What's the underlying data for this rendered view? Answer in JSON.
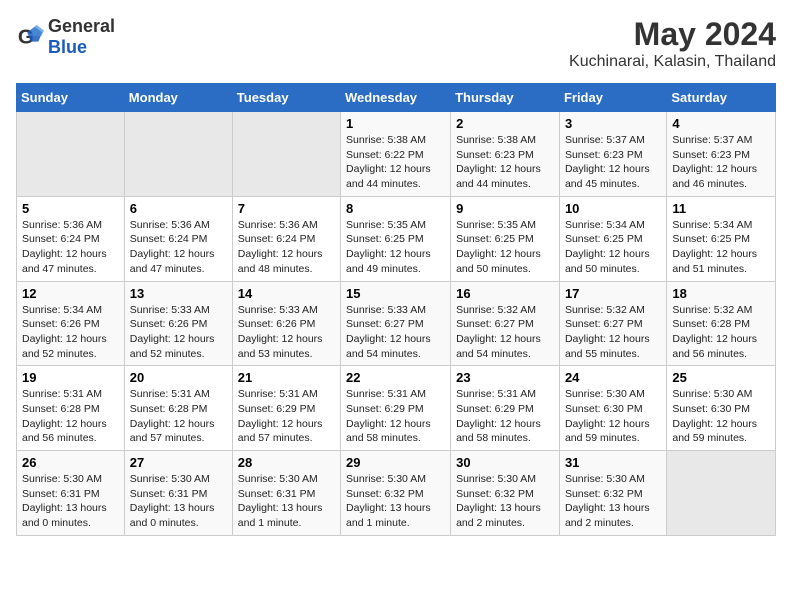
{
  "header": {
    "logo_general": "General",
    "logo_blue": "Blue",
    "title": "May 2024",
    "subtitle": "Kuchinarai, Kalasin, Thailand"
  },
  "days_of_week": [
    "Sunday",
    "Monday",
    "Tuesday",
    "Wednesday",
    "Thursday",
    "Friday",
    "Saturday"
  ],
  "weeks": [
    [
      {
        "day": "",
        "info": ""
      },
      {
        "day": "",
        "info": ""
      },
      {
        "day": "",
        "info": ""
      },
      {
        "day": "1",
        "info": "Sunrise: 5:38 AM\nSunset: 6:22 PM\nDaylight: 12 hours\nand 44 minutes."
      },
      {
        "day": "2",
        "info": "Sunrise: 5:38 AM\nSunset: 6:23 PM\nDaylight: 12 hours\nand 44 minutes."
      },
      {
        "day": "3",
        "info": "Sunrise: 5:37 AM\nSunset: 6:23 PM\nDaylight: 12 hours\nand 45 minutes."
      },
      {
        "day": "4",
        "info": "Sunrise: 5:37 AM\nSunset: 6:23 PM\nDaylight: 12 hours\nand 46 minutes."
      }
    ],
    [
      {
        "day": "5",
        "info": "Sunrise: 5:36 AM\nSunset: 6:24 PM\nDaylight: 12 hours\nand 47 minutes."
      },
      {
        "day": "6",
        "info": "Sunrise: 5:36 AM\nSunset: 6:24 PM\nDaylight: 12 hours\nand 47 minutes."
      },
      {
        "day": "7",
        "info": "Sunrise: 5:36 AM\nSunset: 6:24 PM\nDaylight: 12 hours\nand 48 minutes."
      },
      {
        "day": "8",
        "info": "Sunrise: 5:35 AM\nSunset: 6:25 PM\nDaylight: 12 hours\nand 49 minutes."
      },
      {
        "day": "9",
        "info": "Sunrise: 5:35 AM\nSunset: 6:25 PM\nDaylight: 12 hours\nand 50 minutes."
      },
      {
        "day": "10",
        "info": "Sunrise: 5:34 AM\nSunset: 6:25 PM\nDaylight: 12 hours\nand 50 minutes."
      },
      {
        "day": "11",
        "info": "Sunrise: 5:34 AM\nSunset: 6:25 PM\nDaylight: 12 hours\nand 51 minutes."
      }
    ],
    [
      {
        "day": "12",
        "info": "Sunrise: 5:34 AM\nSunset: 6:26 PM\nDaylight: 12 hours\nand 52 minutes."
      },
      {
        "day": "13",
        "info": "Sunrise: 5:33 AM\nSunset: 6:26 PM\nDaylight: 12 hours\nand 52 minutes."
      },
      {
        "day": "14",
        "info": "Sunrise: 5:33 AM\nSunset: 6:26 PM\nDaylight: 12 hours\nand 53 minutes."
      },
      {
        "day": "15",
        "info": "Sunrise: 5:33 AM\nSunset: 6:27 PM\nDaylight: 12 hours\nand 54 minutes."
      },
      {
        "day": "16",
        "info": "Sunrise: 5:32 AM\nSunset: 6:27 PM\nDaylight: 12 hours\nand 54 minutes."
      },
      {
        "day": "17",
        "info": "Sunrise: 5:32 AM\nSunset: 6:27 PM\nDaylight: 12 hours\nand 55 minutes."
      },
      {
        "day": "18",
        "info": "Sunrise: 5:32 AM\nSunset: 6:28 PM\nDaylight: 12 hours\nand 56 minutes."
      }
    ],
    [
      {
        "day": "19",
        "info": "Sunrise: 5:31 AM\nSunset: 6:28 PM\nDaylight: 12 hours\nand 56 minutes."
      },
      {
        "day": "20",
        "info": "Sunrise: 5:31 AM\nSunset: 6:28 PM\nDaylight: 12 hours\nand 57 minutes."
      },
      {
        "day": "21",
        "info": "Sunrise: 5:31 AM\nSunset: 6:29 PM\nDaylight: 12 hours\nand 57 minutes."
      },
      {
        "day": "22",
        "info": "Sunrise: 5:31 AM\nSunset: 6:29 PM\nDaylight: 12 hours\nand 58 minutes."
      },
      {
        "day": "23",
        "info": "Sunrise: 5:31 AM\nSunset: 6:29 PM\nDaylight: 12 hours\nand 58 minutes."
      },
      {
        "day": "24",
        "info": "Sunrise: 5:30 AM\nSunset: 6:30 PM\nDaylight: 12 hours\nand 59 minutes."
      },
      {
        "day": "25",
        "info": "Sunrise: 5:30 AM\nSunset: 6:30 PM\nDaylight: 12 hours\nand 59 minutes."
      }
    ],
    [
      {
        "day": "26",
        "info": "Sunrise: 5:30 AM\nSunset: 6:31 PM\nDaylight: 13 hours\nand 0 minutes."
      },
      {
        "day": "27",
        "info": "Sunrise: 5:30 AM\nSunset: 6:31 PM\nDaylight: 13 hours\nand 0 minutes."
      },
      {
        "day": "28",
        "info": "Sunrise: 5:30 AM\nSunset: 6:31 PM\nDaylight: 13 hours\nand 1 minute."
      },
      {
        "day": "29",
        "info": "Sunrise: 5:30 AM\nSunset: 6:32 PM\nDaylight: 13 hours\nand 1 minute."
      },
      {
        "day": "30",
        "info": "Sunrise: 5:30 AM\nSunset: 6:32 PM\nDaylight: 13 hours\nand 2 minutes."
      },
      {
        "day": "31",
        "info": "Sunrise: 5:30 AM\nSunset: 6:32 PM\nDaylight: 13 hours\nand 2 minutes."
      },
      {
        "day": "",
        "info": ""
      }
    ]
  ]
}
